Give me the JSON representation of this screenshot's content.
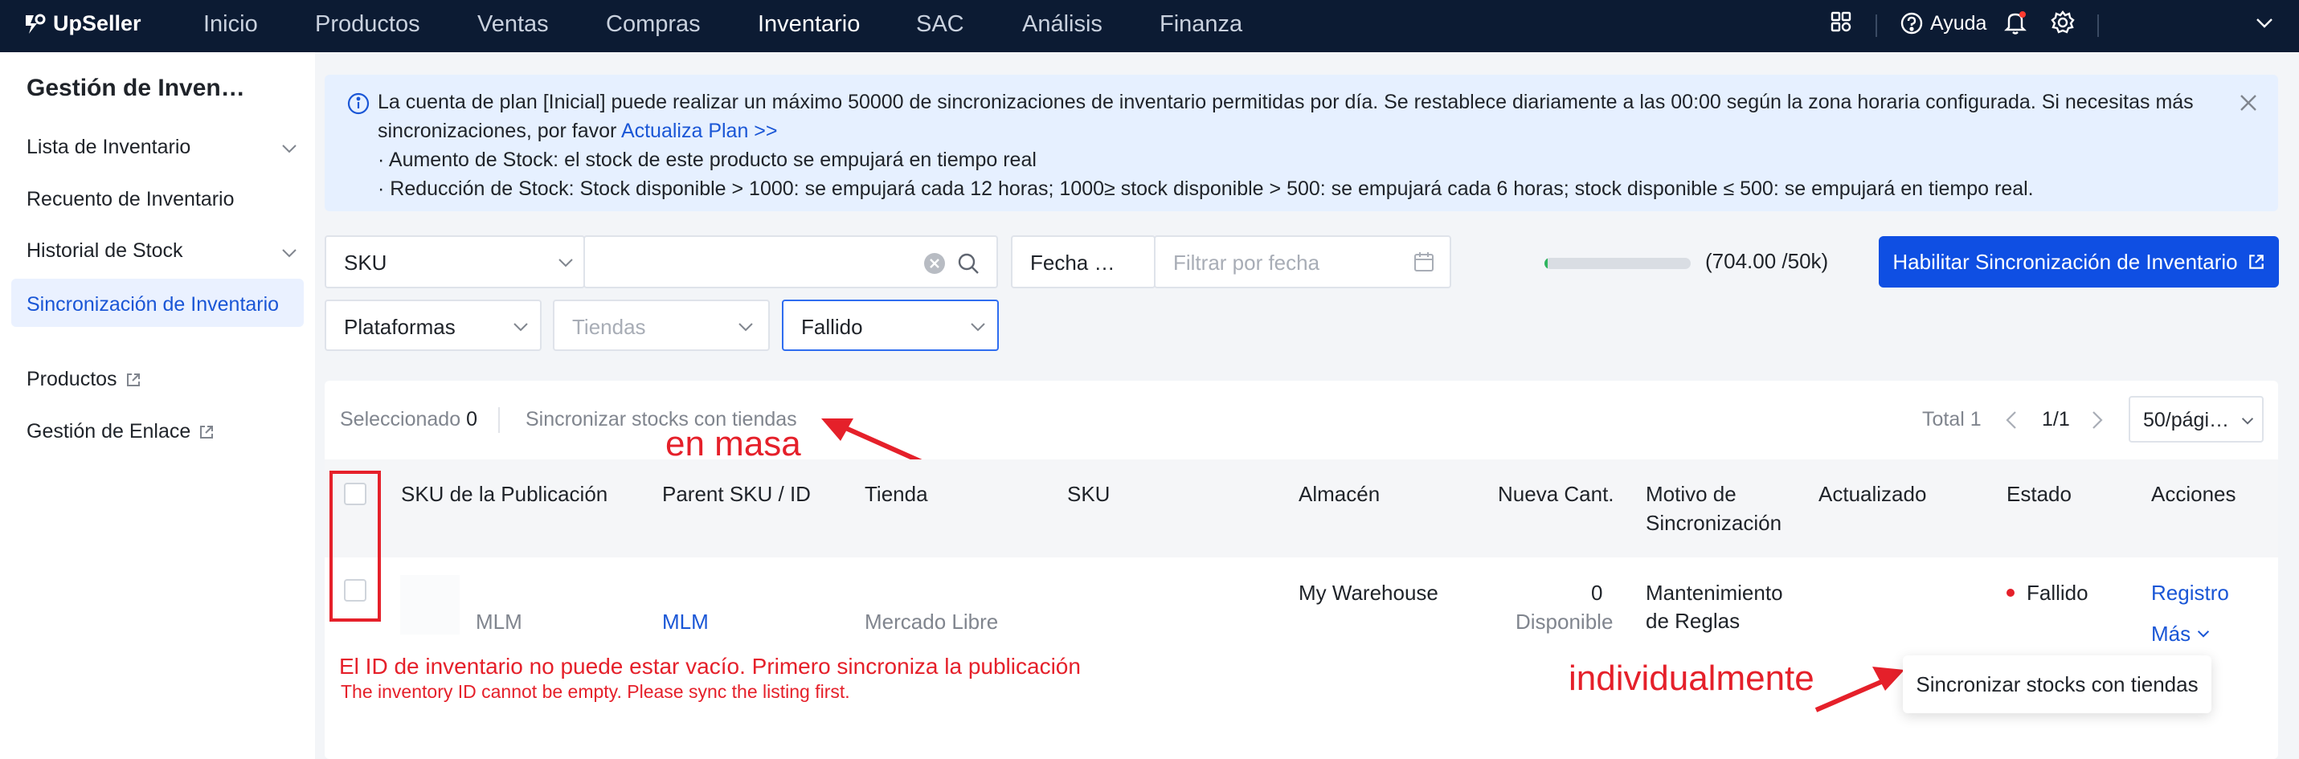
{
  "app": {
    "logo_text": "UpSeller"
  },
  "nav": {
    "items": [
      "Inicio",
      "Productos",
      "Ventas",
      "Compras",
      "Inventario",
      "SAC",
      "Análisis",
      "Finanza"
    ],
    "active": "Inventario",
    "help_label": "Ayuda"
  },
  "sidebar": {
    "title": "Gestión de Inven…",
    "items": [
      {
        "label": "Lista de Inventario"
      },
      {
        "label": "Recuento de Inventario"
      },
      {
        "label": "Historial de Stock"
      },
      {
        "label": "Sincronización de Inventario"
      },
      {
        "label": "Productos"
      },
      {
        "label": "Gestión de Enlace"
      }
    ]
  },
  "notice": {
    "line1": "La cuenta de plan [Inicial] puede realizar un máximo 50000 de sincronizaciones de inventario permitidas por día. Se restablece diariamente a las 00:00 según la zona horaria configurada. Si necesitas más",
    "line2_prefix": "sincronizaciones, por favor ",
    "line2_link": "Actualiza Plan >>",
    "line3": "· Aumento de Stock: el stock de este producto se empujará en tiempo real",
    "line4": "· Reducción de Stock: Stock disponible > 1000: se empujará cada 12 horas; 1000≥ stock disponible > 500: se empujará cada 6 horas; stock disponible ≤ 500: se empujará en tiempo real."
  },
  "filters": {
    "search_field": "SKU",
    "search_value": "",
    "date_field": "Fecha …",
    "date_placeholder": "Filtrar por fecha",
    "platforms": "Plataformas",
    "stores_placeholder": "Tiendas",
    "status": "Fallido"
  },
  "usage": {
    "text": "(704.00 /50k)",
    "fraction": 0.014
  },
  "enable_sync_button": "Habilitar Sincronización de Inventario",
  "toolbar": {
    "selected_label": "Seleccionado",
    "selected_count": "0",
    "bulk_sync": "Sincronizar stocks con tiendas",
    "total": "Total 1",
    "page": "1/1",
    "page_size": "50/pági…"
  },
  "table": {
    "columns": [
      "SKU de la Publicación",
      "Parent SKU / ID",
      "Tienda",
      "SKU",
      "Almacén",
      "Nueva Cant.",
      "Motivo de Sincronización",
      "Actualizado",
      "Estado",
      "Acciones"
    ],
    "rows": [
      {
        "listing_sku": "MLM",
        "parent": "MLM",
        "store": "Mercado Libre",
        "sku": "",
        "warehouse": "My Warehouse",
        "qty": "0",
        "qty_label": "Disponible",
        "reason_line1": "Mantenimiento",
        "reason_line2": "de Reglas",
        "updated": "",
        "status": "Fallido",
        "action_log": "Registro",
        "action_more": "Más",
        "error_es": "El ID de inventario no puede estar vacío. Primero sincroniza la publicación",
        "error_en": "The inventory ID cannot be empty. Please sync the listing first."
      }
    ]
  },
  "dropdown_item": "Sincronizar stocks con tiendas",
  "annotations": {
    "bulk": "en masa",
    "single": "individualmente"
  },
  "colors": {
    "nav_bg": "#0c1b33",
    "primary": "#0f4fe3",
    "error": "#e5202a",
    "progress": "#2fb55f"
  }
}
